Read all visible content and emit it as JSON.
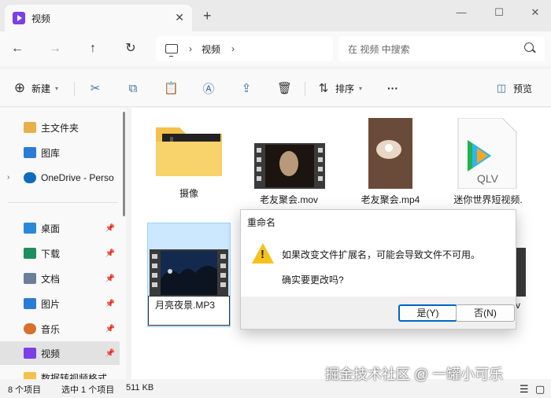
{
  "window": {
    "tab_title": "视频",
    "tab_close": "✕",
    "new_tab": "+",
    "minimize": "—",
    "maximize": "☐",
    "close": "✕"
  },
  "nav": {
    "back": "←",
    "forward": "→",
    "up": "↑",
    "refresh": "↻",
    "breadcrumb_sep": "›",
    "breadcrumb_current": "视频",
    "breadcrumb_more": "›",
    "search_placeholder": "在 视频 中搜索"
  },
  "toolbar": {
    "new_label": "新建",
    "sort_label": "排序",
    "more": "···",
    "preview_label": "预览",
    "icons": [
      "cut-icon",
      "copy-icon",
      "paste-icon",
      "rename-icon",
      "share-icon",
      "delete-icon"
    ]
  },
  "sidebar": {
    "items": [
      {
        "label": "主文件夹",
        "icon": "home-icon",
        "color": "#e8b04a"
      },
      {
        "label": "图库",
        "icon": "gallery-icon",
        "color": "#2b7cd3"
      },
      {
        "label": "OneDrive - Perso",
        "icon": "cloud-icon",
        "color": "#0f6cbd"
      },
      {
        "label": "桌面",
        "icon": "desktop-icon",
        "color": "#2b88d8"
      },
      {
        "label": "下载",
        "icon": "download-icon",
        "color": "#1b8f5c"
      },
      {
        "label": "文档",
        "icon": "document-icon",
        "color": "#6a7f99"
      },
      {
        "label": "图片",
        "icon": "picture-icon",
        "color": "#2b7cd3"
      },
      {
        "label": "音乐",
        "icon": "music-icon",
        "color": "#d9702c"
      },
      {
        "label": "视频",
        "icon": "video-icon",
        "color": "#7b3fe4"
      },
      {
        "label": "数据转视频格式",
        "icon": "folder-icon",
        "color": "#f2c14e"
      }
    ],
    "expand_glyph": "›",
    "pin_glyph": "📌"
  },
  "files": [
    {
      "name": "摄像",
      "type": "folder"
    },
    {
      "name": "老友聚会.mov",
      "type": "video"
    },
    {
      "name": "老友聚会.mp4",
      "type": "video"
    },
    {
      "name": "迷你世界短视频.",
      "type": "video"
    },
    {
      "name": "月亮夜景.MP3",
      "type": "video",
      "renaming": true
    },
    {
      "name": "v",
      "type": "video"
    }
  ],
  "thumb_text": "QLV",
  "dialog": {
    "title": "重命名",
    "warning_glyph": "!",
    "message": "如果改变文件扩展名，可能会导致文件不可用。",
    "question": "确实要更改吗?",
    "yes_label": "是(Y)",
    "no_label": "否(N)"
  },
  "status": {
    "item_count": "8 个项目",
    "selection": "选中 1 个项目",
    "size": "511 KB"
  },
  "watermark": "掘金技术社区 @ 一罐小可乐"
}
